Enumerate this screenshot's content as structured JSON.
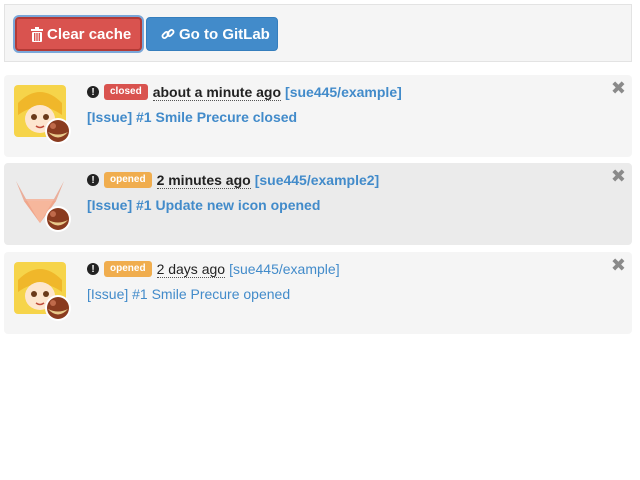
{
  "toolbar": {
    "clear_cache_label": "Clear cache",
    "gitlab_label": "Go to GitLab",
    "danger_color": "#d9534f",
    "primary_color": "#428bca"
  },
  "notifications": [
    {
      "status": "closed",
      "status_color": "#d9534f",
      "time": "about a minute ago",
      "repo": "[sue445/example]",
      "title": "[Issue] #1 Smile Precure closed",
      "avatar": "precure-avatar-icon",
      "read": false
    },
    {
      "status": "opened",
      "status_color": "#f0ad4e",
      "time": "2 minutes ago",
      "repo": "[sue445/example2]",
      "title": "[Issue] #1 Update new icon opened",
      "avatar": "gitlab-fox-avatar-icon",
      "read": false
    },
    {
      "status": "opened",
      "status_color": "#f0ad4e",
      "time": "2 days ago",
      "repo": "[sue445/example]",
      "title": "[Issue] #1 Smile Precure opened",
      "avatar": "precure-avatar-icon",
      "read": true
    }
  ],
  "close_glyph": "✖",
  "alert_glyph": "!"
}
